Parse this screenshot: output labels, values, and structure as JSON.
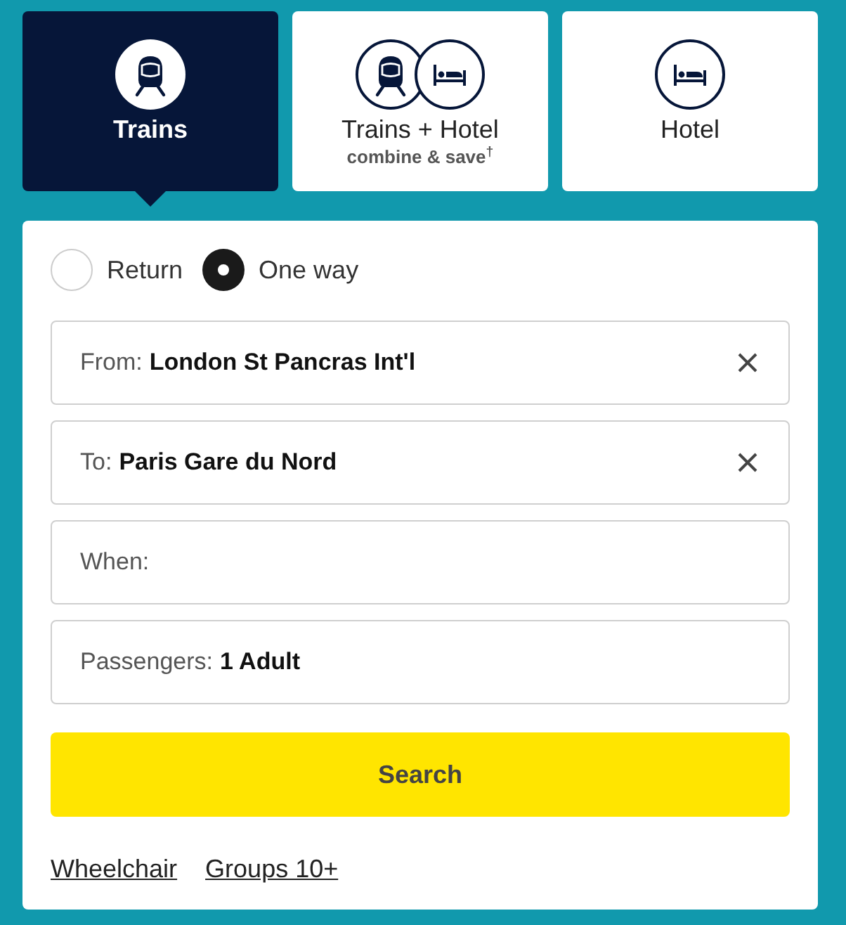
{
  "tabs": [
    {
      "kind": "train",
      "label": "Trains",
      "selected": true
    },
    {
      "kind": "bundle",
      "label": "Trains + Hotel",
      "sublabel": "combine & save$^{†}$",
      "selected": false
    },
    {
      "kind": "hotel",
      "label": "Hotel",
      "selected": false
    }
  ],
  "trip_type": [
    {
      "label": "Return",
      "selected": false
    },
    {
      "label": "One way",
      "selected": true
    }
  ],
  "fields": [
    {
      "label": "From:",
      "value": "London St Pancras Int'l",
      "clearable": true
    },
    {
      "label": "To:",
      "value": "Paris Gare du Nord",
      "clearable": true
    },
    {
      "label": "When:",
      "clearable": false
    },
    {
      "label": "Passengers:",
      "value": "1 Adult",
      "clearable": false
    }
  ],
  "search_button": "Search",
  "links": [
    "Wheelchair",
    "Groups 10+"
  ]
}
